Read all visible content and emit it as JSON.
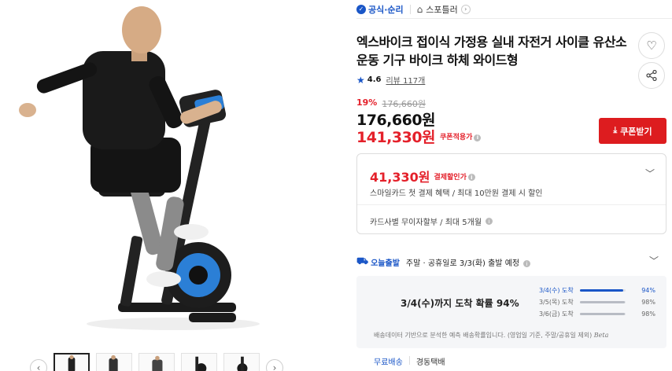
{
  "gallery": {
    "thumbnail_count": 5,
    "prev_icon": "chevron-left-icon",
    "next_icon": "chevron-right-icon"
  },
  "topbar": {
    "official_label": "공식·순리",
    "store_label": "스포틀러"
  },
  "product": {
    "title": "엑스바이크 접이식 가정용 실내 자전거 사이클 유산소 운동 기구 바이크 하체 와이드형",
    "rating": "4.6",
    "review_label": "리뷰 117개"
  },
  "pricing": {
    "discount_pct": "19%",
    "original_price": "176,660원",
    "price": "176,660원",
    "coupon_price": "141,330원",
    "coupon_label": "쿠폰적용가",
    "coupon_button": "쿠폰받기"
  },
  "payment_card": {
    "pay_price": "41,330원",
    "pay_label": "결제할인가",
    "pay_desc": "스마일카드 첫 결제 혜택 / 최대 10만원 결제 시 할인",
    "installment": "카드사별 무이자할부 / 최대 5개월"
  },
  "shipping": {
    "today_label": "오늘출발",
    "departure_text": "주말 · 공휴일로 3/3(화) 출발 예정",
    "arrival_prob": "3/4(수)까지 도착 확률 94%",
    "rows": [
      {
        "date": "3/4(수) 도착",
        "pct": "94%",
        "value": 0.94
      },
      {
        "date": "3/5(목) 도착",
        "pct": "98%",
        "value": 0.98
      },
      {
        "date": "3/6(금) 도착",
        "pct": "98%",
        "value": 0.98
      }
    ],
    "note": "배송데이터 기반으로 분석한 예측 배송확률입니다. (영업일 기준, 주말/공휴일 제외)",
    "note_brand": "Beta",
    "free_label": "무료배송",
    "courier": "경동택배"
  },
  "colors": {
    "accent_blue": "#1a56c7",
    "price_red": "#e4202a",
    "coupon_button": "#dd1c1f"
  }
}
